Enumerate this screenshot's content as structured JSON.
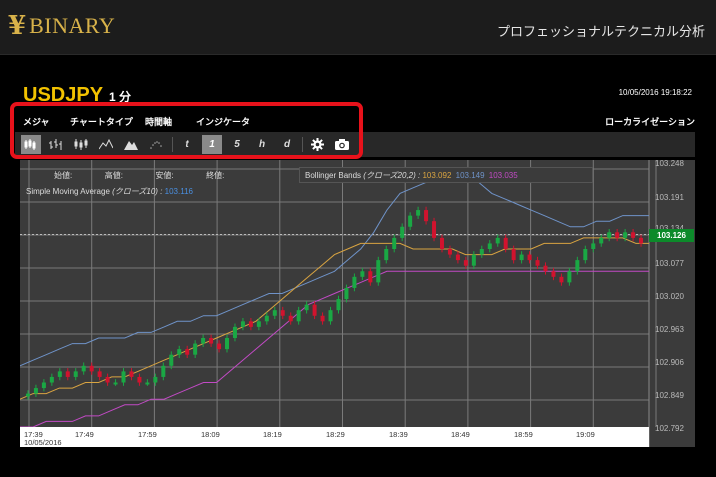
{
  "brand": {
    "logo_mark": "¥",
    "name": "BINARY",
    "tagline": "プロフェッショナルテクニカル分析"
  },
  "instrument": {
    "symbol": "USDJPY",
    "interval": "1 分",
    "datetime": "10/05/2016 19:18:22"
  },
  "menu": {
    "items": [
      "メジャ",
      "チャートタイプ",
      "時間軸",
      "インジケータ"
    ],
    "localization": "ローカライゼーション"
  },
  "toolbar": {
    "chart_types": [
      "candlestick-icon",
      "ohlc-bar-icon",
      "hollow-candle-icon",
      "line-icon",
      "area-icon",
      "dot-icon"
    ],
    "active_chart_type": "candlestick-icon",
    "timeframes": [
      "t",
      "1",
      "5",
      "h",
      "d"
    ],
    "active_timeframe": "1",
    "actions": [
      "gear-icon",
      "camera-icon"
    ]
  },
  "legend": {
    "ohlc": {
      "open_label": "始値:",
      "high_label": "高値:",
      "low_label": "安値:",
      "close_label": "終値:"
    },
    "bollinger": {
      "label": "Bollinger Bands",
      "params": "(クローズ20,2) :",
      "values": [
        "103.092",
        "103.149",
        "103.035"
      ]
    },
    "sma": {
      "label": "Simple Moving Average",
      "params": "(クローズ10) :",
      "value": "103.116"
    }
  },
  "colors": {
    "bg": "#000000",
    "chart_bg": "#3b3b3b",
    "up_candle": "#1aa844",
    "down_candle": "#d1132e",
    "bollinger_top": "#6f93c9",
    "bollinger_mid": "#d9a441",
    "bollinger_bottom": "#c24ac5",
    "sma": "#4a8fe0",
    "highlight": "#e8121b",
    "symbol": "#f2c200"
  },
  "price_axis": {
    "labels": [
      "103.191",
      "103.134",
      "103.077",
      "103.020",
      "102.963",
      "102.906",
      "102.849",
      "102.792"
    ],
    "top_partial": "103.248",
    "current_price": "103.126"
  },
  "time_axis": {
    "labels": [
      "17:39",
      "17:49",
      "17:59",
      "18:09",
      "18:19",
      "18:29",
      "18:39",
      "18:49",
      "18:59",
      "19:09"
    ],
    "date": "10/05/2016"
  },
  "chart_data": {
    "type": "candlestick",
    "ylim": [
      102.78,
      103.26
    ],
    "candles_close": [
      102.84,
      102.85,
      102.86,
      102.87,
      102.88,
      102.87,
      102.88,
      102.89,
      102.88,
      102.87,
      102.86,
      102.86,
      102.88,
      102.87,
      102.86,
      102.86,
      102.87,
      102.89,
      102.91,
      102.92,
      102.91,
      102.93,
      102.94,
      102.93,
      102.92,
      102.94,
      102.96,
      102.97,
      102.96,
      102.97,
      102.98,
      102.99,
      102.98,
      102.97,
      102.99,
      103.0,
      102.98,
      102.97,
      102.99,
      103.01,
      103.03,
      103.05,
      103.06,
      103.04,
      103.08,
      103.1,
      103.12,
      103.14,
      103.16,
      103.17,
      103.15,
      103.12,
      103.1,
      103.09,
      103.08,
      103.07,
      103.09,
      103.1,
      103.11,
      103.12,
      103.1,
      103.08,
      103.09,
      103.08,
      103.07,
      103.06,
      103.05,
      103.04,
      103.06,
      103.08,
      103.1,
      103.11,
      103.12,
      103.13,
      103.12,
      103.13,
      103.12,
      103.11
    ],
    "bollinger_top": [
      102.89,
      102.9,
      102.91,
      102.92,
      102.93,
      102.93,
      102.94,
      102.94,
      102.94,
      102.95,
      102.95,
      102.96,
      102.97,
      102.97,
      102.98,
      102.98,
      102.99,
      103.0,
      103.01,
      103.02,
      103.02,
      103.03,
      103.04,
      103.05,
      103.06,
      103.08,
      103.1,
      103.13,
      103.17,
      103.2,
      103.21,
      103.22,
      103.24,
      103.24,
      103.23,
      103.22,
      103.2,
      103.19,
      103.18,
      103.17,
      103.16,
      103.15,
      103.14,
      103.14,
      103.15,
      103.15,
      103.16,
      103.16,
      103.16
    ],
    "bollinger_mid": [
      102.83,
      102.84,
      102.84,
      102.85,
      102.85,
      102.86,
      102.86,
      102.87,
      102.87,
      102.88,
      102.89,
      102.9,
      102.91,
      102.92,
      102.93,
      102.94,
      102.95,
      102.96,
      102.97,
      102.99,
      103.01,
      103.03,
      103.05,
      103.07,
      103.09,
      103.1,
      103.11,
      103.11,
      103.11,
      103.11,
      103.1,
      103.1,
      103.1,
      103.1,
      103.09,
      103.09,
      103.09,
      103.1,
      103.1,
      103.1,
      103.11,
      103.11,
      103.11,
      103.12,
      103.12,
      103.12,
      103.12,
      103.11,
      103.11
    ],
    "bollinger_bottom": [
      102.78,
      102.78,
      102.79,
      102.79,
      102.79,
      102.8,
      102.8,
      102.81,
      102.82,
      102.82,
      102.83,
      102.83,
      102.84,
      102.85,
      102.86,
      102.86,
      102.88,
      102.9,
      102.92,
      102.94,
      102.96,
      102.98,
      103.0,
      103.01,
      103.02,
      103.03,
      103.04,
      103.05,
      103.06,
      103.06,
      103.06,
      103.06,
      103.06,
      103.06,
      103.06,
      103.06,
      103.06,
      103.06,
      103.06,
      103.06,
      103.06,
      103.06,
      103.06,
      103.06,
      103.06,
      103.06,
      103.06,
      103.06,
      103.06
    ]
  }
}
